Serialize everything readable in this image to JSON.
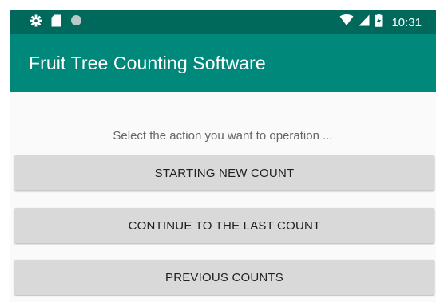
{
  "status_bar": {
    "time": "10:31",
    "icons": [
      "settings-icon",
      "sd-card-icon",
      "circle-dot-icon",
      "wifi-icon",
      "signal-icon",
      "battery-charging-icon"
    ],
    "background_color": "#00695c"
  },
  "app_bar": {
    "title": "Fruit Tree Counting Software",
    "background_color": "#00897b"
  },
  "main": {
    "prompt": "Select the action you want to operation ...",
    "buttons": [
      {
        "label": "STARTING NEW COUNT"
      },
      {
        "label": "CONTINUE TO THE LAST COUNT"
      },
      {
        "label": "PREVIOUS COUNTS"
      }
    ]
  }
}
